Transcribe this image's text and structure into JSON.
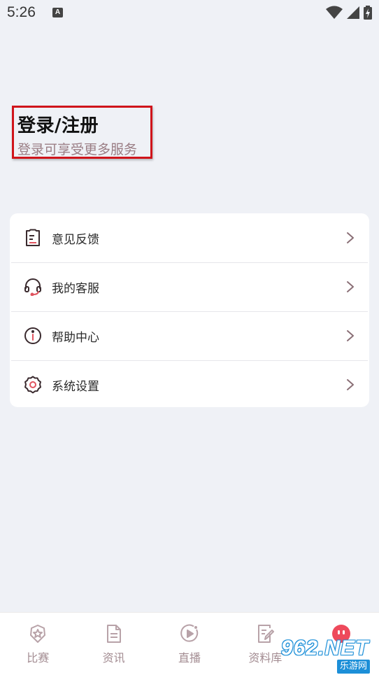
{
  "status_bar": {
    "time": "5:26",
    "notification_letter": "A"
  },
  "header": {
    "login_title": "登录/注册",
    "login_subtitle": "登录可享受更多服务"
  },
  "menu": {
    "items": [
      {
        "label": "意见反馈",
        "icon": "feedback-icon"
      },
      {
        "label": "我的客服",
        "icon": "headset-icon"
      },
      {
        "label": "帮助中心",
        "icon": "info-icon"
      },
      {
        "label": "系统设置",
        "icon": "gear-icon"
      }
    ]
  },
  "bottom_nav": {
    "items": [
      {
        "label": "比赛",
        "icon": "star-badge-icon"
      },
      {
        "label": "资讯",
        "icon": "document-icon"
      },
      {
        "label": "直播",
        "icon": "play-icon"
      },
      {
        "label": "资料库",
        "icon": "note-edit-icon"
      },
      {
        "label": "",
        "icon": "profile-face-icon"
      }
    ]
  },
  "watermark": {
    "main": "962.NET",
    "sub": "乐游网"
  },
  "colors": {
    "background": "#eff1f6",
    "accent": "#e0545f",
    "icon_dark": "#3a2a2e",
    "muted_text": "#a38c92",
    "highlight_border": "#d0141b"
  }
}
